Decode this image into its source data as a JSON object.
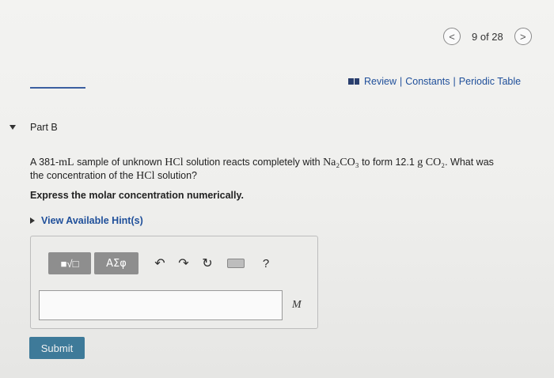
{
  "nav": {
    "prev_icon": "chevron-left-icon",
    "next_icon": "chevron-right-icon",
    "counter": "9 of 28",
    "prev_glyph": "<",
    "next_glyph": ">"
  },
  "links": {
    "book_icon": "book-icon",
    "review": "Review",
    "constants": "Constants",
    "periodic": "Periodic Table",
    "separator": "|"
  },
  "part": {
    "label": "Part B"
  },
  "question": {
    "p1": "A 381-",
    "mL": "mL",
    "p2": " sample of unknown ",
    "HCl": "HCl",
    "p3": " solution reacts completely with ",
    "na2co3": "Na₂CO₃",
    "p4": " to form 12.1 ",
    "g": "g",
    "co2": "CO₂",
    "p5": ". What was",
    "p6": "the concentration of the ",
    "HCl2": "HCl",
    "p7": " solution?"
  },
  "instruction": "Express the molar concentration numerically.",
  "hint": "View Available Hint(s)",
  "toolbar": {
    "templates_label": "■√□",
    "greek_label": "ΑΣφ",
    "undo_glyph": "↶",
    "redo_glyph": "↷",
    "reset_glyph": "↻",
    "help_glyph": "?"
  },
  "answer": {
    "value": "",
    "unit": "M"
  },
  "submit_label": "Submit",
  "colors": {
    "submit": "#3e7a99",
    "link": "#1f4f9a",
    "toolbar_button": "#8e8e8e"
  }
}
